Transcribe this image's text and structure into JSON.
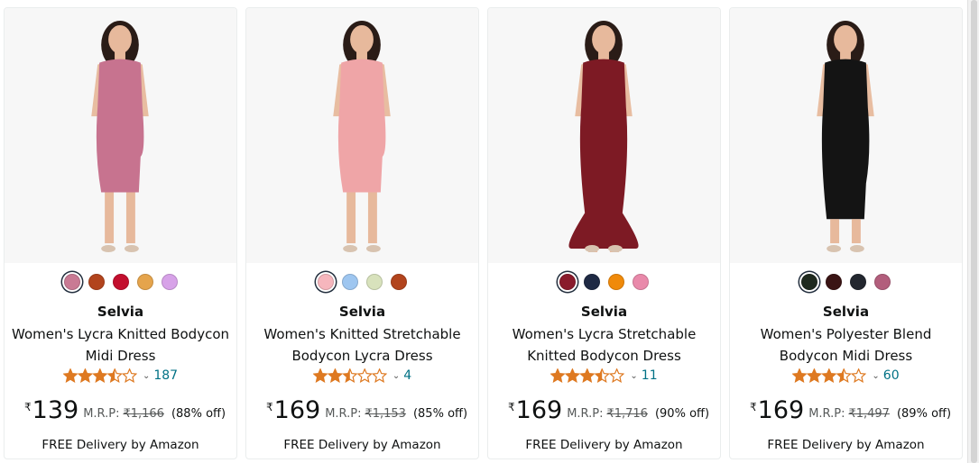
{
  "colors": {
    "star": "#de7921",
    "link": "#007185",
    "text": "#0f1111"
  },
  "products": [
    {
      "image_name": "pink-off-shoulder-bodycon-dress-image",
      "dress_color": "#c7738f",
      "swatches": [
        "#c97a94",
        "#b2441d",
        "#c30f2e",
        "#e5a44c",
        "#d7a2e8"
      ],
      "selected_swatch": 0,
      "brand": "Selvia",
      "title": "Women's Lycra Knitted Bodycon Midi Dress",
      "rating": 3.5,
      "review_count": "187",
      "currency": "₹",
      "price": "139",
      "mrp_label": "M.R.P:",
      "mrp": "₹1,166",
      "discount": "(88% off)",
      "delivery": "FREE Delivery by Amazon"
    },
    {
      "image_name": "light-pink-flutter-sleeve-dress-image",
      "dress_color": "#efa5a7",
      "swatches": [
        "#f6b6bd",
        "#9ec6f0",
        "#d8e2bc",
        "#b2441d"
      ],
      "selected_swatch": 0,
      "brand": "Selvia",
      "title": "Women's Knitted Stretchable Bodycon Lycra Dress",
      "rating": 2.5,
      "review_count": "4",
      "currency": "₹",
      "price": "169",
      "mrp_label": "M.R.P:",
      "mrp": "₹1,153",
      "discount": "(85% off)",
      "delivery": "FREE Delivery by Amazon"
    },
    {
      "image_name": "maroon-ruffle-mermaid-dress-image",
      "dress_color": "#7d1a24",
      "swatches": [
        "#8a1b2c",
        "#1f2a44",
        "#f08a0a",
        "#e989aa"
      ],
      "selected_swatch": 0,
      "brand": "Selvia",
      "title": "Women's Lycra Stretchable Knitted Bodycon Dress",
      "rating": 3.5,
      "review_count": "11",
      "currency": "₹",
      "price": "169",
      "mrp_label": "M.R.P:",
      "mrp": "₹1,716",
      "discount": "(90% off)",
      "delivery": "FREE Delivery by Amazon"
    },
    {
      "image_name": "black-puff-sleeve-ruched-dress-image",
      "dress_color": "#141414",
      "swatches": [
        "#1f2a1f",
        "#3a1414",
        "#23272f",
        "#b25e7c"
      ],
      "selected_swatch": 0,
      "brand": "Selvia",
      "title": "Women's Polyester Blend Bodycon Midi Dress",
      "rating": 3.5,
      "review_count": "60",
      "currency": "₹",
      "price": "169",
      "mrp_label": "M.R.P:",
      "mrp": "₹1,497",
      "discount": "(89% off)",
      "delivery": "FREE Delivery by Amazon"
    }
  ]
}
